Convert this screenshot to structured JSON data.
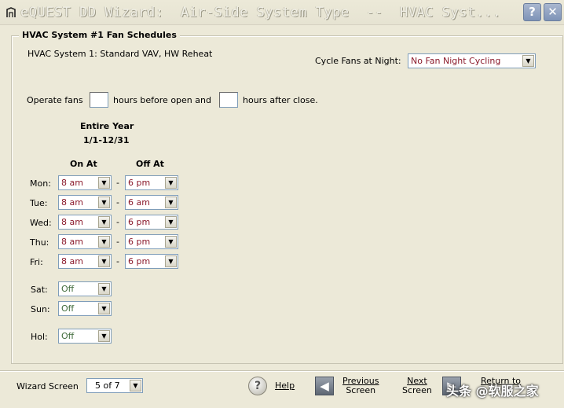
{
  "window": {
    "title": "eQUEST DD Wizard:  Air-Side System Type  --  HVAC Syst...",
    "help_label": "?",
    "close_label": "✕"
  },
  "group": {
    "legend": "HVAC System #1 Fan Schedules",
    "system_label": "HVAC System 1:  Standard VAV, HW Reheat"
  },
  "cycle_fans": {
    "label": "Cycle Fans at Night:",
    "value": "No Fan Night Cycling"
  },
  "operate_fans": {
    "prefix": "Operate fans",
    "middle": "hours before open and",
    "suffix": "hours after close.",
    "before_hours": "",
    "after_hours": ""
  },
  "period": {
    "title": "Entire Year",
    "range": "1/1-12/31"
  },
  "columns": {
    "on_at": "On At",
    "off_at": "Off At"
  },
  "weekdays": [
    {
      "label": "Mon:",
      "on": "8 am",
      "off": "6 pm"
    },
    {
      "label": "Tue:",
      "on": "8 am",
      "off": "6 am"
    },
    {
      "label": "Wed:",
      "on": "8 am",
      "off": "6 pm"
    },
    {
      "label": "Thu:",
      "on": "8 am",
      "off": "6 pm"
    },
    {
      "label": "Fri:",
      "on": "8 am",
      "off": "6 pm"
    }
  ],
  "dash": "-",
  "weekend": [
    {
      "label": "Sat:",
      "value": "Off"
    },
    {
      "label": "Sun:",
      "value": "Off"
    },
    {
      "label": "Hol:",
      "value": "Off"
    }
  ],
  "footer": {
    "wizard_screen_label": "Wizard Screen",
    "wizard_screen_value": "5 of 7",
    "help": "Help",
    "previous_line1": "Previous",
    "previous_line2": "Screen",
    "next_line1": "Next",
    "next_line2": "Screen",
    "return_line1": "Return to"
  },
  "watermark": "头条 @软服之家",
  "colors": {
    "schedule_value": "#8b1a2b",
    "off_value": "#3f6b3a",
    "background": "#ece9d8"
  }
}
